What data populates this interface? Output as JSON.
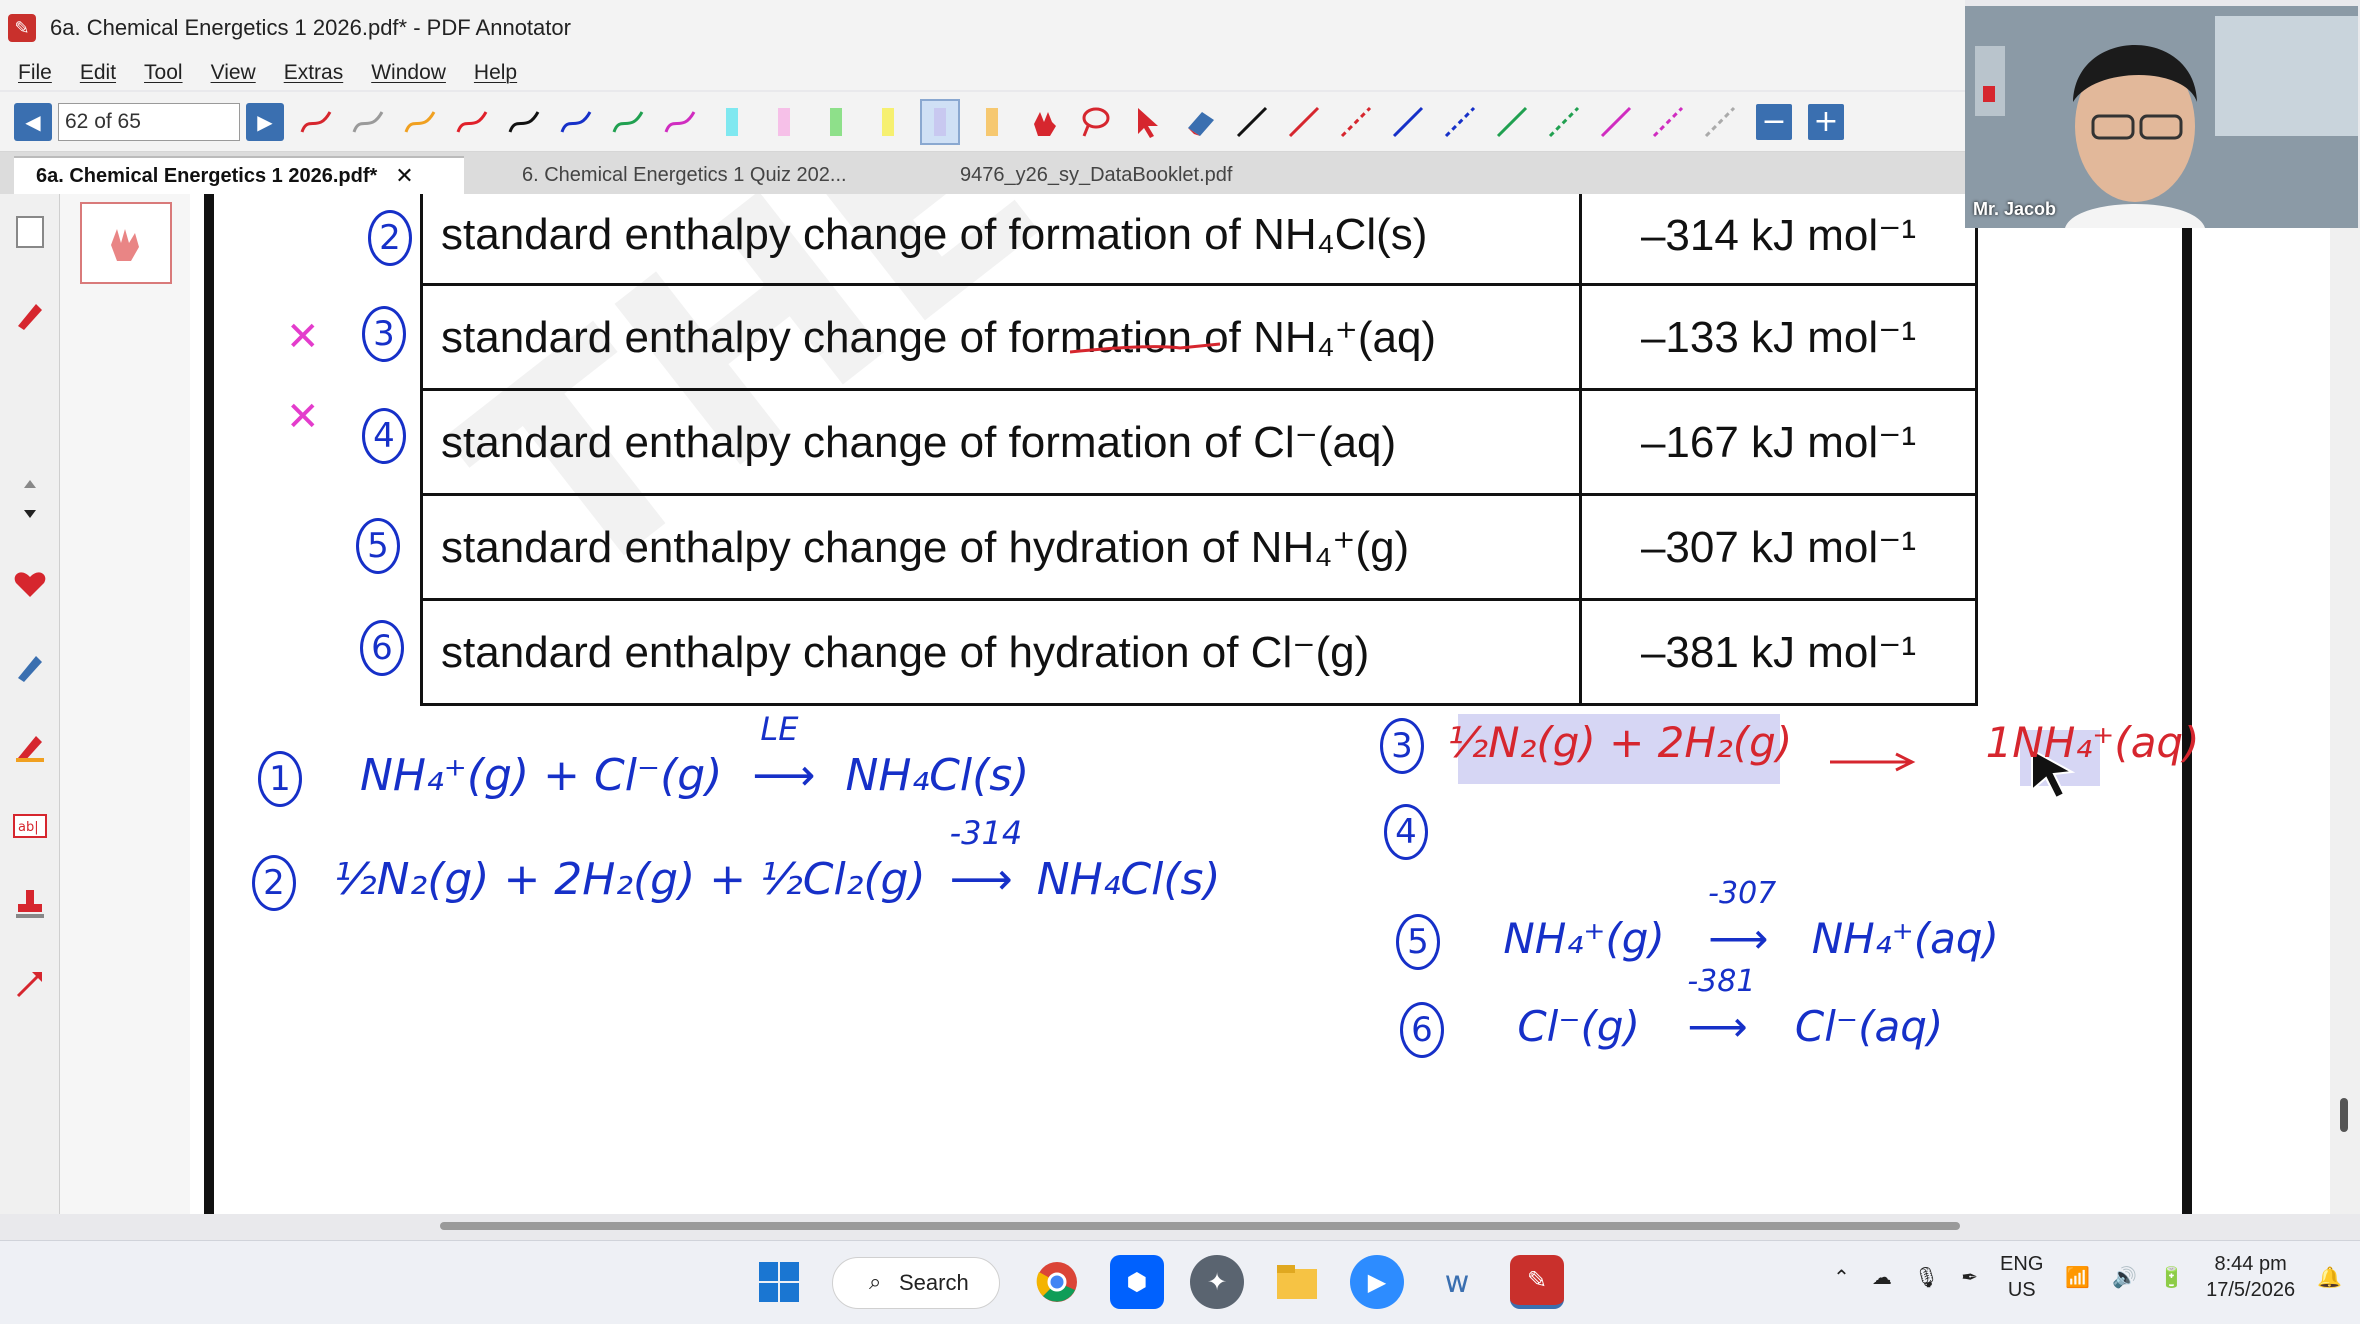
{
  "window": {
    "title": "6a. Chemical Energetics 1 2026.pdf* - PDF Annotator"
  },
  "menu": [
    "File",
    "Edit",
    "Tool",
    "View",
    "Extras",
    "Window",
    "Help"
  ],
  "toolbar": {
    "page_indicator": "62 of 65"
  },
  "tabs": [
    {
      "label": "6a. Chemical Energetics 1 2026.pdf*",
      "active": true
    },
    {
      "label": "6. Chemical Energetics 1 Quiz 202...",
      "active": false
    },
    {
      "label": "9476_y26_sy_DataBooklet.pdf",
      "active": false
    }
  ],
  "table": {
    "rows": [
      {
        "label": "standard enthalpy change of formation of NH₄Cl(s)",
        "value": "–314 kJ mol⁻¹"
      },
      {
        "label": "standard enthalpy change of formation of NH₄⁺(aq)",
        "value": "–133 kJ mol⁻¹"
      },
      {
        "label": "standard enthalpy change of formation of Cl⁻(aq)",
        "value": "–167 kJ mol⁻¹"
      },
      {
        "label": "standard enthalpy change of hydration of NH₄⁺(g)",
        "value": "–307 kJ mol⁻¹"
      },
      {
        "label": "standard enthalpy change of hydration of Cl⁻(g)",
        "value": "–381 kJ mol⁻¹"
      }
    ]
  },
  "annotations": {
    "row_numbers": [
      "2",
      "3",
      "4",
      "5",
      "6"
    ],
    "eq1": {
      "num": "1",
      "lhs": "NH₄⁺(g) + Cl⁻(g)",
      "label": "LE",
      "rhs": "NH₄Cl(s)"
    },
    "eq2": {
      "num": "2",
      "lhs": "½N₂(g) + 2H₂(g) + ½Cl₂(g)",
      "label": "-314",
      "rhs": "NH₄Cl(s)"
    },
    "eq3": {
      "num": "3",
      "lhs": "½N₂(g) + 2H₂(g)",
      "rhs": "1NH₄⁺(aq)"
    },
    "eq4": {
      "num": "4"
    },
    "eq5": {
      "num": "5",
      "lhs": "NH₄⁺(g)",
      "label": "-307",
      "rhs": "NH₄⁺(aq)"
    },
    "eq6": {
      "num": "6",
      "lhs": "Cl⁻(g)",
      "label": "-381",
      "rhs": "Cl⁻(aq)"
    }
  },
  "webcam": {
    "name": "Mr. Jacob"
  },
  "taskbar": {
    "search_label": "Search",
    "lang_top": "ENG",
    "lang_bottom": "US",
    "time": "8:44 pm",
    "date": "17/5/2026"
  },
  "colors": {
    "accent": "#3a6fb0",
    "ink_blue": "#1630c8",
    "ink_red": "#d6262e",
    "ink_pink": "#e43ccc"
  }
}
